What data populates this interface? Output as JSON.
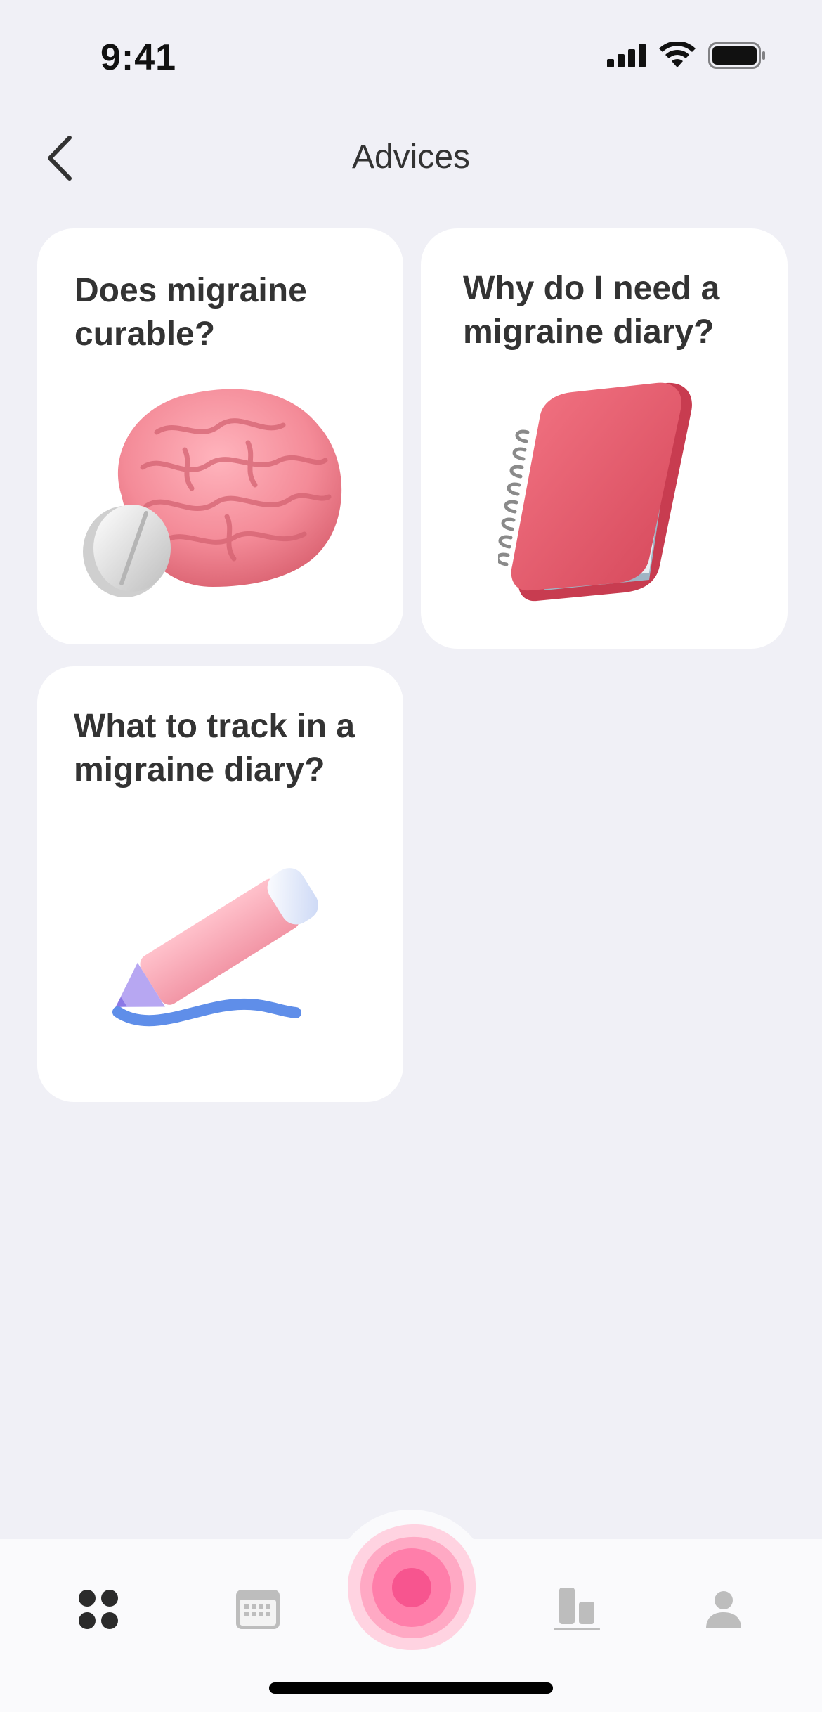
{
  "status_bar": {
    "time": "9:41",
    "icons": [
      "signal-icon",
      "wifi-icon",
      "battery-icon"
    ]
  },
  "nav": {
    "back_icon": "chevron-left-icon",
    "title": "Advices"
  },
  "cards": [
    {
      "title": "Does migraine curable?",
      "image": "brain-with-pill-illustration"
    },
    {
      "title": "Why do I need a migraine diary?",
      "image": "spiral-notebook-illustration"
    },
    {
      "title": "What to track in a migraine diary?",
      "image": "pencil-with-stroke-illustration"
    }
  ],
  "tabbar": {
    "tabs": [
      {
        "icon": "grid-dots-icon",
        "active": true
      },
      {
        "icon": "calendar-icon",
        "active": false
      },
      {
        "icon": "record-attack-icon",
        "center": true
      },
      {
        "icon": "bar-chart-icon",
        "active": false
      },
      {
        "icon": "profile-icon",
        "active": false
      }
    ]
  },
  "colors": {
    "background": "#f0f0f6",
    "card": "#ffffff",
    "accent_pink": "#f7558f",
    "text": "#333333",
    "inactive_icon": "#bdbdbd"
  }
}
